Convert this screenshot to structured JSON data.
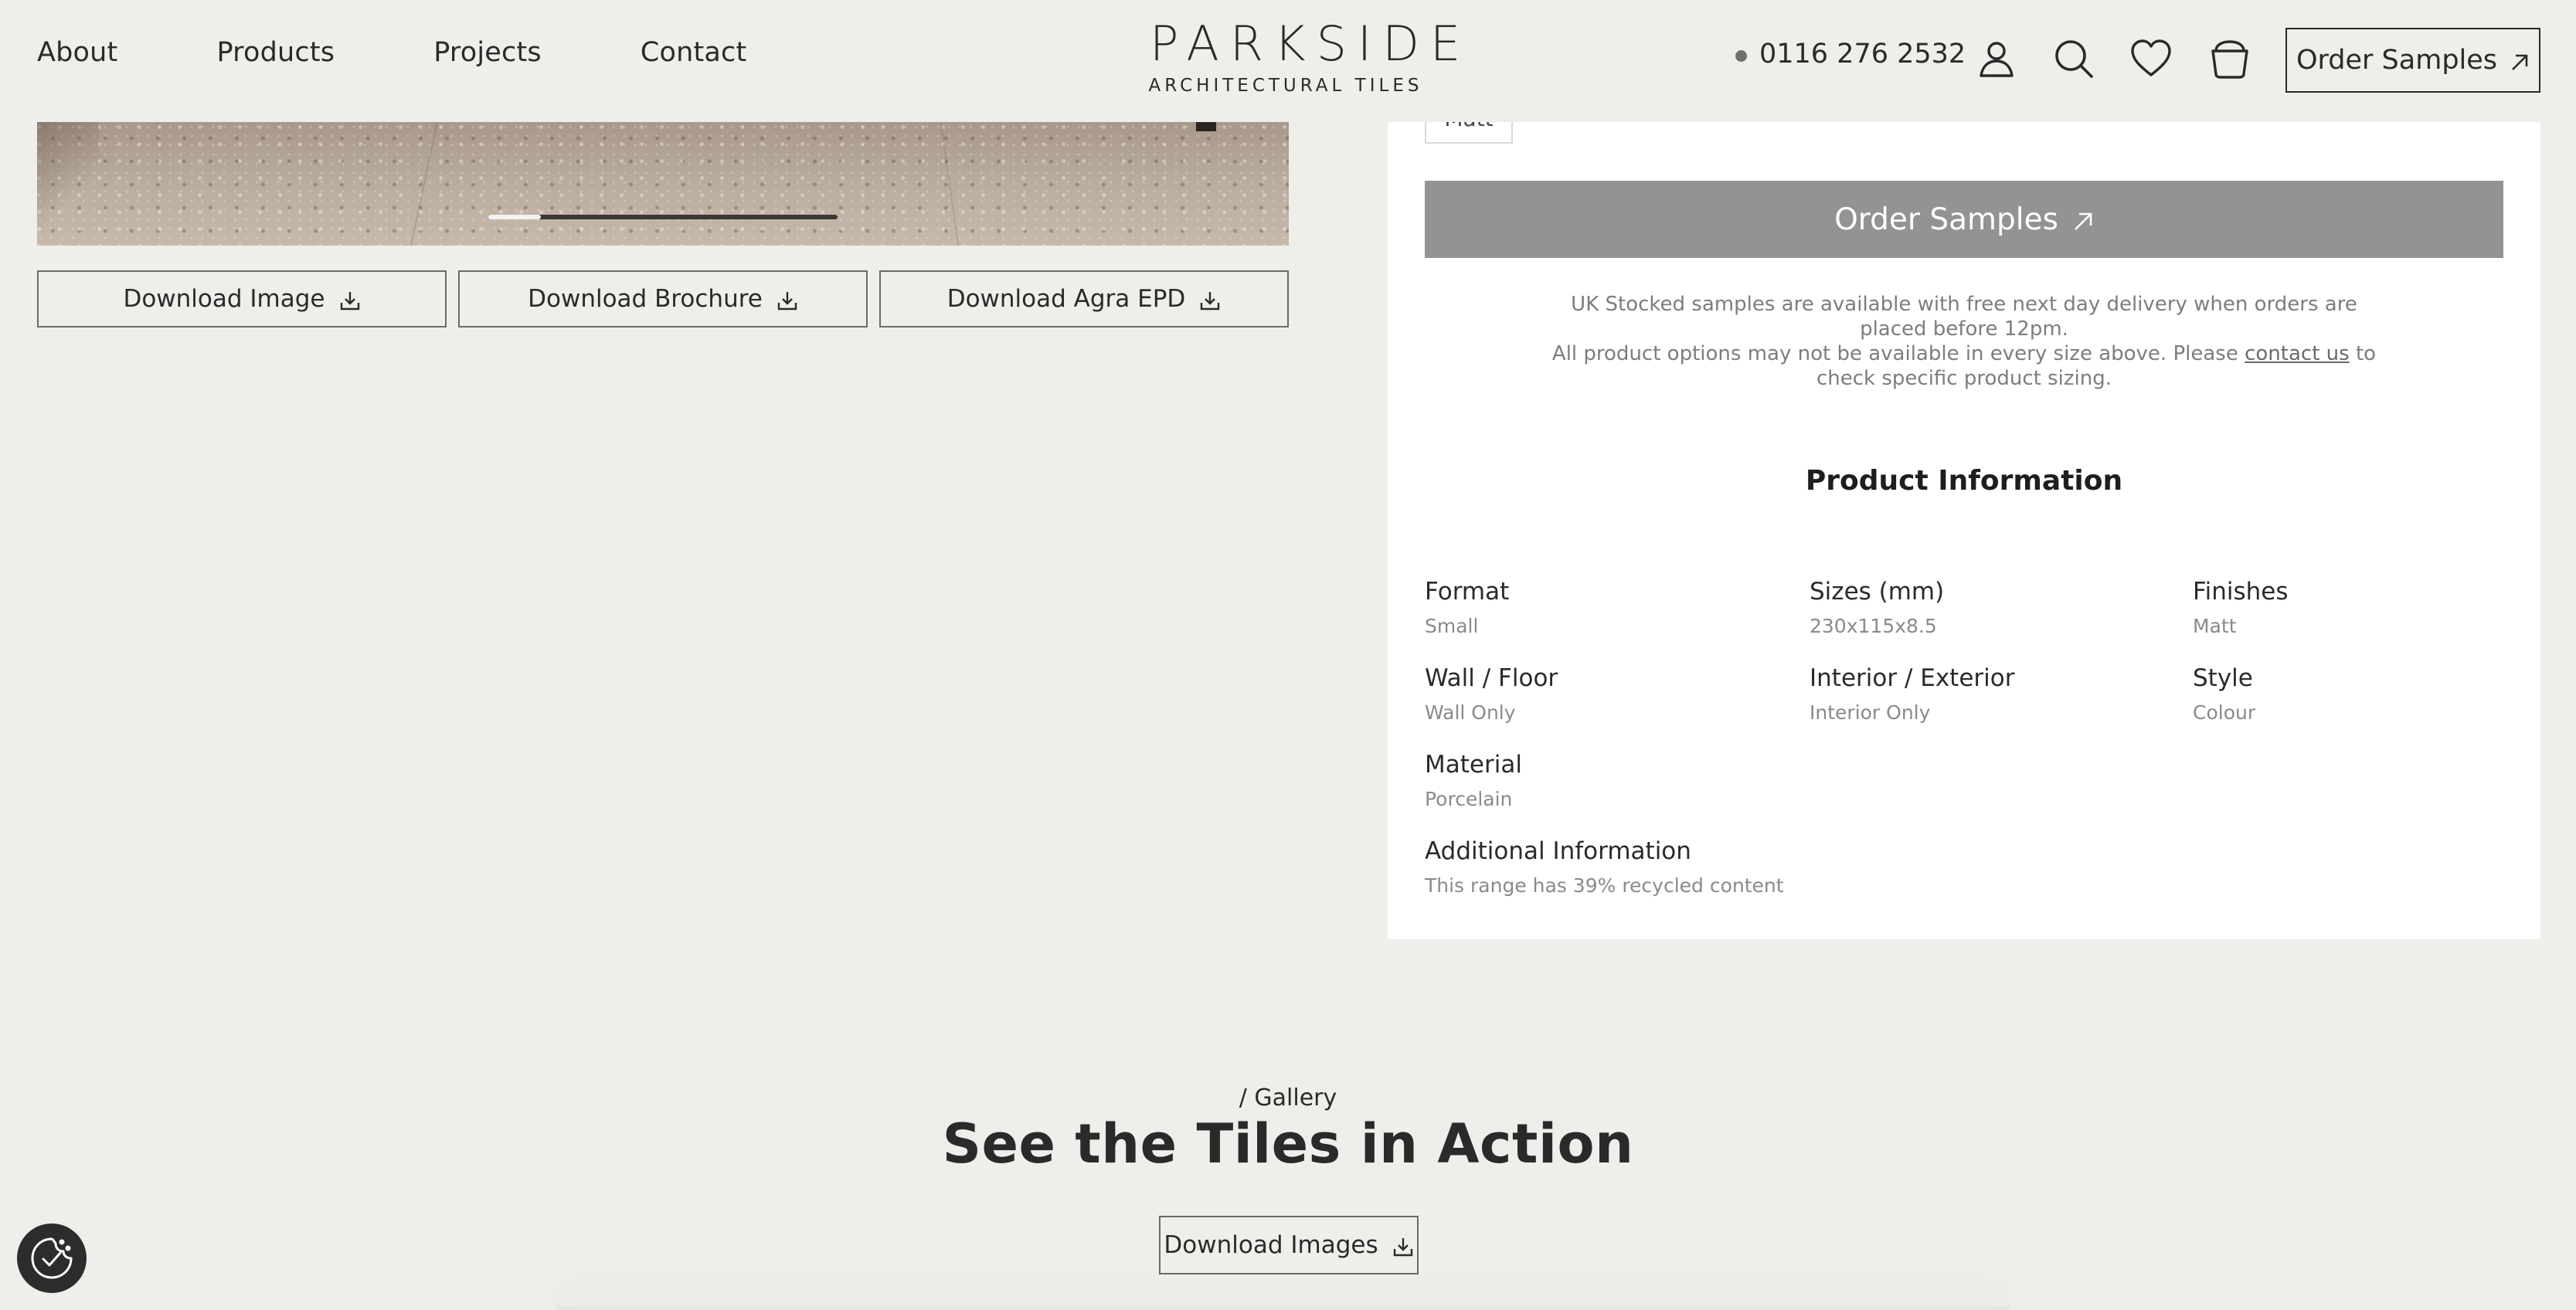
{
  "header": {
    "nav": [
      "About",
      "Products",
      "Projects",
      "Contact"
    ],
    "logo_main": "PARKSIDE",
    "logo_sub": "ARCHITECTURAL TILES",
    "phone": "0116 276 2532",
    "order_samples": "Order Samples",
    "icons": [
      "user-icon",
      "search-icon",
      "heart-icon",
      "basket-icon"
    ]
  },
  "downloads": {
    "image": "Download Image",
    "brochure": "Download Brochure",
    "epd": "Download Agra EPD"
  },
  "carousel": {
    "progress": 0.15
  },
  "product": {
    "finish_chip": "Matt",
    "order_samples": "Order Samples",
    "note_line1": "UK Stocked samples are available with free next day delivery when orders are placed before 12pm.",
    "note_line2_pre": "All product options may not be available in every size above. Please",
    "note_link": "contact us",
    "note_line2_post": "to check specific product sizing.",
    "info_title": "Product Information",
    "specs": {
      "format": {
        "label": "Format",
        "value": "Small"
      },
      "sizes": {
        "label": "Sizes (mm)",
        "value": "230x115x8.5"
      },
      "finishes": {
        "label": "Finishes",
        "value": "Matt"
      },
      "wall_floor": {
        "label": "Wall / Floor",
        "value": "Wall Only"
      },
      "interior_exterior": {
        "label": "Interior / Exterior",
        "value": "Interior Only"
      },
      "style": {
        "label": "Style",
        "value": "Colour"
      },
      "material": {
        "label": "Material",
        "value": "Porcelain"
      },
      "additional": {
        "label": "Additional Information",
        "value": "This range has 39% recycled content"
      }
    }
  },
  "gallery": {
    "kicker": "/ Gallery",
    "title": "See the Tiles in Action",
    "download": "Download Images"
  },
  "colors": {
    "background": "#efeeeb",
    "panel": "#ffffff",
    "order_button": "#939393",
    "text": "#2a2a2a"
  }
}
